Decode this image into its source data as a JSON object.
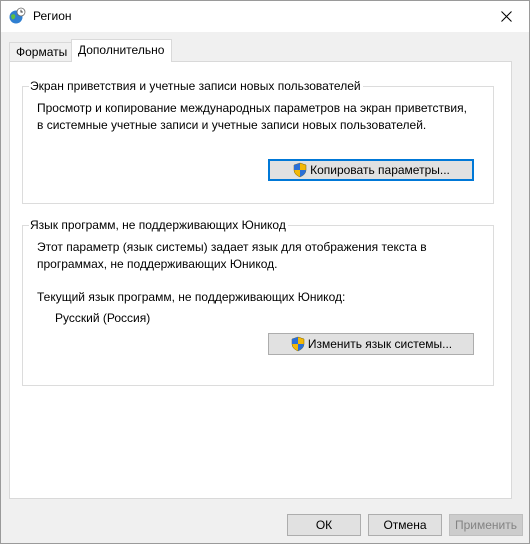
{
  "window": {
    "title": "Регион",
    "close_symbol": "✕",
    "icon": "globe-clock-icon"
  },
  "tabs": [
    {
      "label": "Форматы",
      "active": false
    },
    {
      "label": "Дополнительно",
      "active": true
    }
  ],
  "welcome_group": {
    "title": "Экран приветствия и учетные записи новых пользователей",
    "description_line1": "Просмотр и копирование международных параметров на экран приветствия,",
    "description_line2": "в системные учетные записи и учетные записи новых пользователей.",
    "button_label": "Копировать параметры...",
    "button_icon": "uac-shield-icon"
  },
  "unicode_group": {
    "title": "Язык программ, не поддерживающих Юникод",
    "description_line1": "Этот параметр (язык системы) задает язык для отображения текста в",
    "description_line2": "программах, не поддерживающих Юникод.",
    "current_label": "Текущий язык программ, не поддерживающих Юникод:",
    "current_value": "Русский (Россия)",
    "button_label": "Изменить язык системы...",
    "button_icon": "uac-shield-icon"
  },
  "footer": {
    "ok_label": "ОК",
    "cancel_label": "Отмена",
    "apply_label": "Применить",
    "apply_enabled": false
  },
  "colors": {
    "focus_border": "#0078d7",
    "dialog_background": "#f0f0f0",
    "panel_background": "#ffffff"
  }
}
